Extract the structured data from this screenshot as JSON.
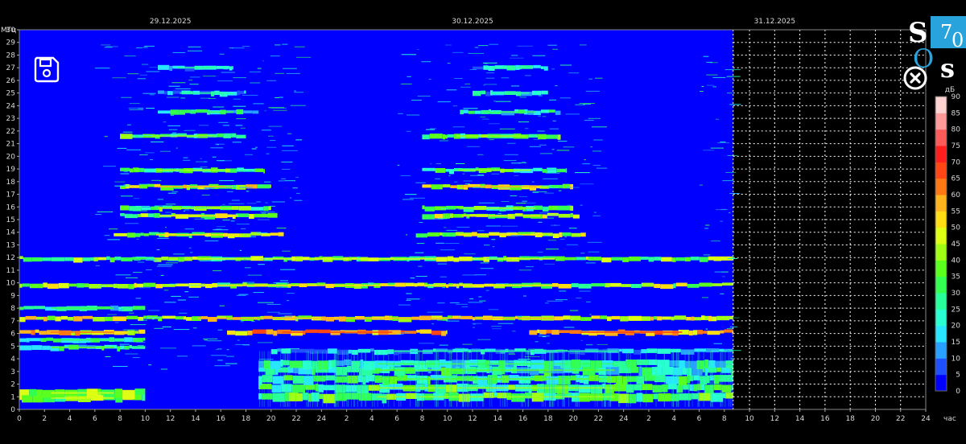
{
  "chart_data": {
    "type": "heatmap",
    "y_axis": {
      "unit_label": "МГц",
      "min": 0,
      "max": 30,
      "ticks": [
        0,
        1,
        2,
        3,
        4,
        5,
        6,
        7,
        8,
        9,
        10,
        11,
        12,
        13,
        14,
        15,
        16,
        17,
        18,
        19,
        20,
        21,
        22,
        23,
        24,
        25,
        26,
        27,
        28,
        29,
        30
      ]
    },
    "x_axis": {
      "unit_label": "час",
      "tick_labels": [
        "0",
        "2",
        "4",
        "6",
        "8",
        "10",
        "12",
        "14",
        "16",
        "18",
        "20",
        "22",
        "24",
        "2",
        "4",
        "6",
        "8",
        "10",
        "12",
        "14",
        "16",
        "18",
        "20",
        "22",
        "24",
        "2",
        "4",
        "6",
        "8",
        "10",
        "12",
        "14",
        "16",
        "18",
        "20",
        "22",
        "24"
      ],
      "date_labels": [
        "29.12.2025",
        "30.12.2025",
        "31.12.2025"
      ],
      "hours_total": 72,
      "hours_with_data": 56.7
    },
    "color_scale": {
      "unit_label": "дБ",
      "ticks": [
        0,
        5,
        10,
        15,
        20,
        25,
        30,
        35,
        40,
        45,
        50,
        55,
        60,
        65,
        70,
        75,
        80,
        85,
        90
      ],
      "colors": [
        "#0000ff",
        "#1e50ff",
        "#28a0ff",
        "#28e6ff",
        "#28ffd2",
        "#28ff9a",
        "#32ff50",
        "#5aff1e",
        "#a0ff14",
        "#dcff14",
        "#ffdc14",
        "#ffb41e",
        "#ff7814",
        "#ff4614",
        "#ff1e1e",
        "#ff5a5a",
        "#ff9a9a",
        "#ffd2d2",
        "#ffffff"
      ]
    },
    "background_color": "#0000ff",
    "grid": "dashed-white-in-empty-region",
    "bands": [
      {
        "freq": 0.9,
        "from": 0,
        "to": 10,
        "level": 35
      },
      {
        "freq": 1.3,
        "from": 0,
        "to": 10,
        "level": 35
      },
      {
        "freq": 1.0,
        "from": 19,
        "to": 56.7,
        "level": 30
      },
      {
        "freq": 1.7,
        "from": 19,
        "to": 56.7,
        "level": 28
      },
      {
        "freq": 2.4,
        "from": 19,
        "to": 56.7,
        "level": 25
      },
      {
        "freq": 3.1,
        "from": 19,
        "to": 56.7,
        "level": 22
      },
      {
        "freq": 3.6,
        "from": 19,
        "to": 56.7,
        "level": 20
      },
      {
        "freq": 4.9,
        "from": 0,
        "to": 10,
        "level": 22
      },
      {
        "freq": 4.6,
        "from": 20,
        "to": 56.7,
        "level": 12
      },
      {
        "freq": 5.5,
        "from": 0,
        "to": 10,
        "level": 20
      },
      {
        "freq": 6.1,
        "from": 0,
        "to": 10,
        "level": 50
      },
      {
        "freq": 6.1,
        "from": 16.5,
        "to": 34,
        "level": 55
      },
      {
        "freq": 6.1,
        "from": 40.5,
        "to": 56.7,
        "level": 55
      },
      {
        "freq": 7.2,
        "from": 0,
        "to": 56.7,
        "level": 45
      },
      {
        "freq": 8.0,
        "from": 0,
        "to": 10,
        "level": 20
      },
      {
        "freq": 9.8,
        "from": 0,
        "to": 56.7,
        "level": 38
      },
      {
        "freq": 11.9,
        "from": 0,
        "to": 56.7,
        "level": 35
      },
      {
        "freq": 13.8,
        "from": 7.5,
        "to": 21,
        "level": 40
      },
      {
        "freq": 13.8,
        "from": 31.5,
        "to": 45,
        "level": 40
      },
      {
        "freq": 15.3,
        "from": 8,
        "to": 20.5,
        "level": 38
      },
      {
        "freq": 15.3,
        "from": 32,
        "to": 44.5,
        "level": 38
      },
      {
        "freq": 15.9,
        "from": 8,
        "to": 20,
        "level": 30
      },
      {
        "freq": 15.9,
        "from": 32,
        "to": 44,
        "level": 30
      },
      {
        "freq": 17.6,
        "from": 8,
        "to": 20,
        "level": 42
      },
      {
        "freq": 17.6,
        "from": 32,
        "to": 44,
        "level": 42
      },
      {
        "freq": 18.9,
        "from": 8,
        "to": 19.5,
        "level": 28
      },
      {
        "freq": 18.9,
        "from": 32,
        "to": 43.5,
        "level": 28
      },
      {
        "freq": 21.6,
        "from": 8,
        "to": 18,
        "level": 30
      },
      {
        "freq": 21.6,
        "from": 32,
        "to": 43,
        "level": 30
      },
      {
        "freq": 23.5,
        "from": 11,
        "to": 19,
        "level": 20
      },
      {
        "freq": 23.5,
        "from": 35,
        "to": 43,
        "level": 20
      },
      {
        "freq": 25.0,
        "from": 11,
        "to": 18,
        "level": 15
      },
      {
        "freq": 25.0,
        "from": 36,
        "to": 42,
        "level": 15
      },
      {
        "freq": 27.0,
        "from": 11,
        "to": 17,
        "level": 15
      },
      {
        "freq": 27.0,
        "from": 36,
        "to": 42,
        "level": 15
      }
    ]
  },
  "logo": {
    "letters": [
      "S",
      "7",
      "0",
      "O",
      "s"
    ],
    "bg": "#29a3dc"
  },
  "icons": {
    "save": "save-icon",
    "close": "close-icon"
  }
}
